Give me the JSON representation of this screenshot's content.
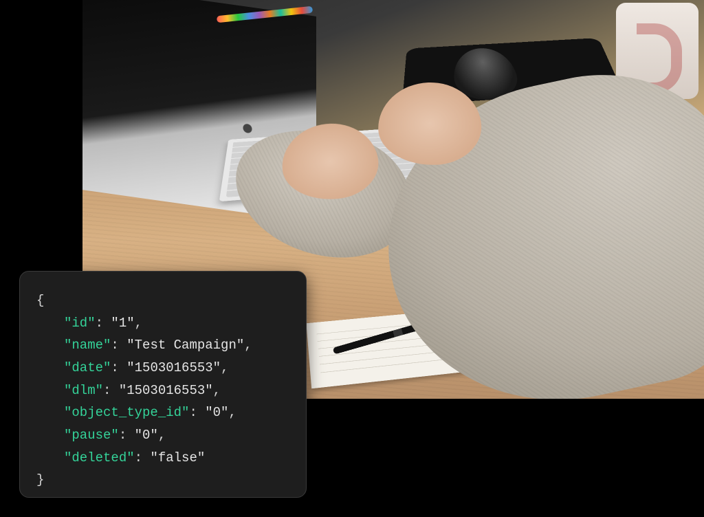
{
  "code": {
    "open_brace": "{",
    "close_brace": "}",
    "pairs": [
      {
        "key": "\"id\"",
        "value": "\"1\""
      },
      {
        "key": "\"name\"",
        "value": "\"Test Campaign\""
      },
      {
        "key": "\"date\"",
        "value": "\"1503016553\""
      },
      {
        "key": "\"dlm\"",
        "value": "\"1503016553\""
      },
      {
        "key": "\"object_type_id\"",
        "value": "\"0\""
      },
      {
        "key": "\"pause\"",
        "value": "\"0\""
      },
      {
        "key": "\"deleted\"",
        "value": "\"false\""
      }
    ]
  }
}
